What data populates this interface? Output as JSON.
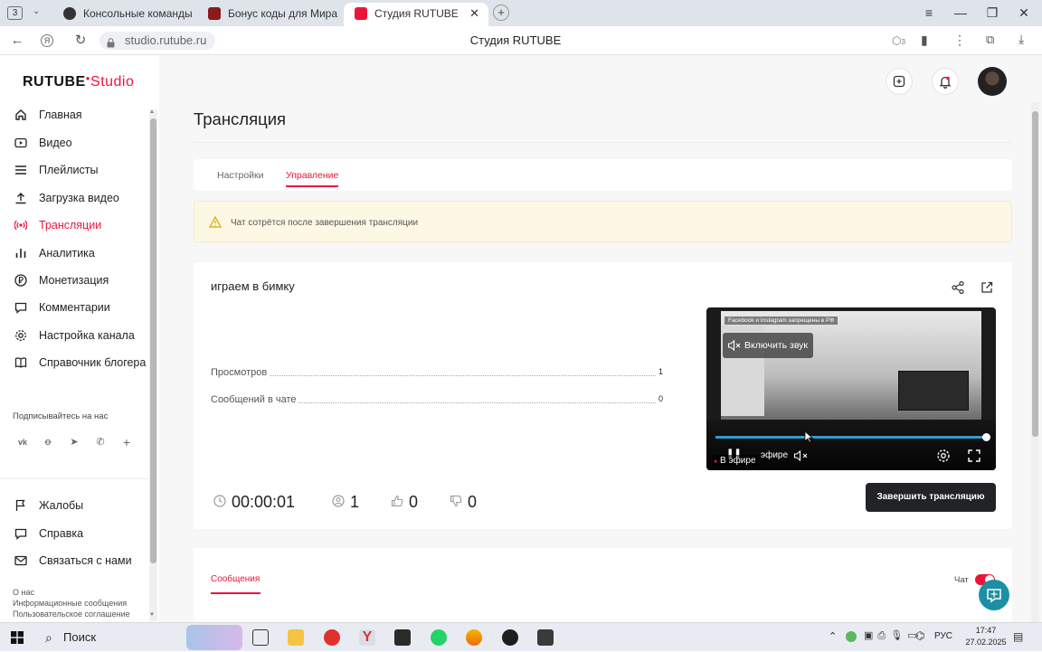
{
  "browser": {
    "tab_count": "3",
    "tabs": [
      {
        "title": "Консольные команды | Ti",
        "active": false
      },
      {
        "title": "Бонус коды для Мира тан",
        "active": false
      },
      {
        "title": "Студия RUTUBE",
        "active": true
      }
    ],
    "url": "studio.rutube.ru",
    "page_title": "Студия RUTUBE",
    "extension_badge": "3"
  },
  "sidebar": {
    "logo_main": "RUTUBE",
    "logo_studio": "Studio",
    "items": [
      {
        "label": "Главная",
        "icon": "home-icon"
      },
      {
        "label": "Видео",
        "icon": "video-icon"
      },
      {
        "label": "Плейлисты",
        "icon": "playlist-icon"
      },
      {
        "label": "Загрузка видео",
        "icon": "upload-icon"
      },
      {
        "label": "Трансляции",
        "icon": "broadcast-icon",
        "active": true
      },
      {
        "label": "Аналитика",
        "icon": "analytics-icon"
      },
      {
        "label": "Монетизация",
        "icon": "ruble-icon"
      },
      {
        "label": "Комментарии",
        "icon": "comments-icon"
      },
      {
        "label": "Настройка канала",
        "icon": "settings-icon"
      },
      {
        "label": "Справочник блогера",
        "icon": "book-icon"
      }
    ],
    "follow_label": "Подписывайтесь на нас",
    "social": [
      "vk-icon",
      "ok-icon",
      "telegram-icon",
      "viber-icon",
      "plus-icon"
    ],
    "bottom_items": [
      {
        "label": "Жалобы",
        "icon": "flag-icon"
      },
      {
        "label": "Справка",
        "icon": "help-icon"
      },
      {
        "label": "Связаться с нами",
        "icon": "mail-icon"
      }
    ],
    "footer_links": [
      "О нас",
      "Информационные сообщения",
      "Пользовательское соглашение"
    ]
  },
  "main": {
    "title": "Трансляция",
    "tabs": [
      {
        "label": "Настройки",
        "active": false
      },
      {
        "label": "Управление",
        "active": true
      }
    ],
    "warning": "Чат сотрётся после завершения трансляции",
    "stream": {
      "name": "играем в бимку",
      "stats": [
        {
          "label": "Просмотров",
          "value": "1"
        },
        {
          "label": "Сообщений в чате",
          "value": "0"
        }
      ],
      "duration": "00:00:01",
      "viewers": "1",
      "likes": "0",
      "dislikes": "0",
      "end_button": "Завершить трансляцию"
    },
    "player": {
      "unmute_label": "Включить звук",
      "banner_text": "Facebook и Instagram запрещены в РФ",
      "live_label": "В эфире",
      "live_label_back": "эфире",
      "progress": 1.0
    },
    "messages_tab": "Сообщения",
    "chat_label": "Чат"
  },
  "taskbar": {
    "search_placeholder": "Поиск",
    "lang": "РУС",
    "time": "17:47",
    "date": "27.02.2025"
  },
  "colors": {
    "accent": "#ed143b",
    "dark_button": "#222326",
    "warning_bg": "#fdf8e3",
    "fab": "#1d8fa5"
  }
}
